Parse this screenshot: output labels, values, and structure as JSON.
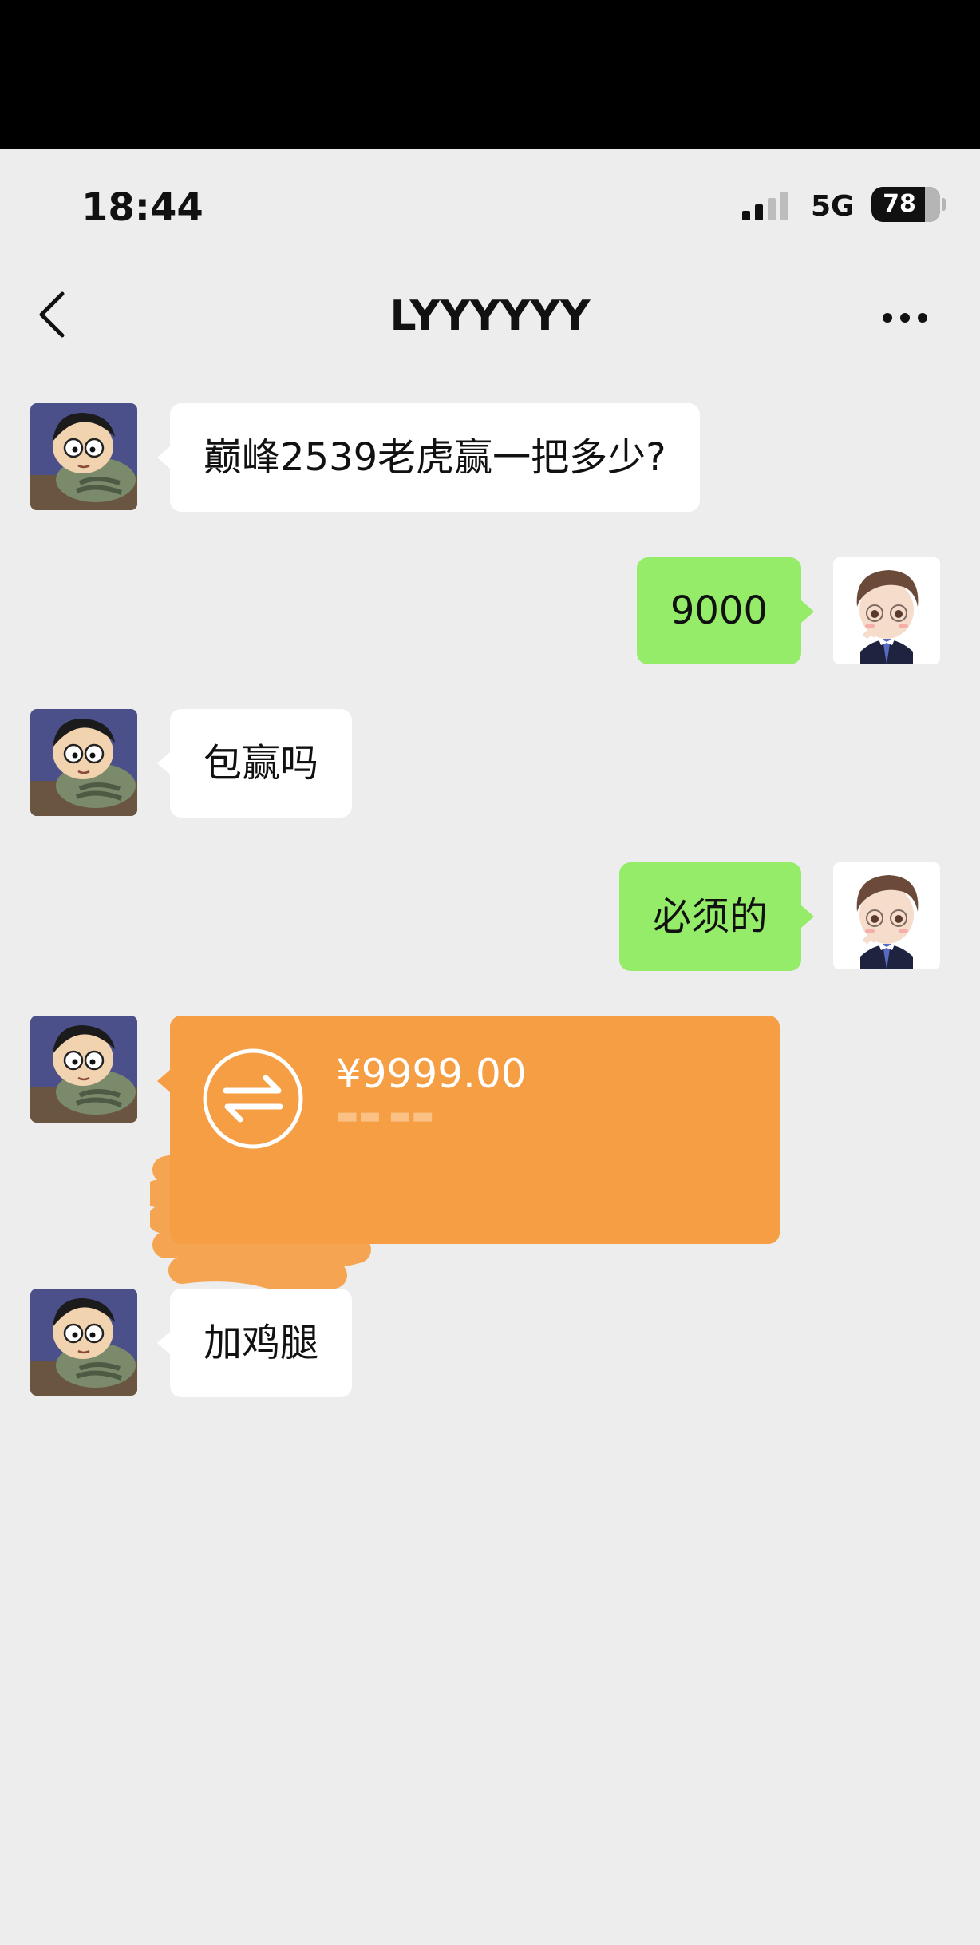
{
  "status_bar": {
    "time": "18:44",
    "network": "5G",
    "battery": "78",
    "battery_level": 0.78
  },
  "header": {
    "title": "LYYYYYY"
  },
  "messages": [
    {
      "side": "in",
      "text": "巅峰2539老虎赢一把多少?"
    },
    {
      "side": "out",
      "text": "9000"
    },
    {
      "side": "in",
      "text": "包赢吗"
    },
    {
      "side": "out",
      "text": "必须的"
    },
    {
      "side": "in",
      "type": "transfer",
      "amount": "¥9999.00"
    },
    {
      "side": "in",
      "text": "加鸡腿"
    }
  ],
  "colors": {
    "incoming_bubble": "#ffffff",
    "outgoing_bubble": "#95ec69",
    "transfer_card": "#f59e44",
    "background": "#ededed"
  },
  "icons": [
    "back-chevron-icon",
    "more-dots-icon",
    "signal-icon",
    "battery-icon",
    "transfer-arrows-icon"
  ]
}
